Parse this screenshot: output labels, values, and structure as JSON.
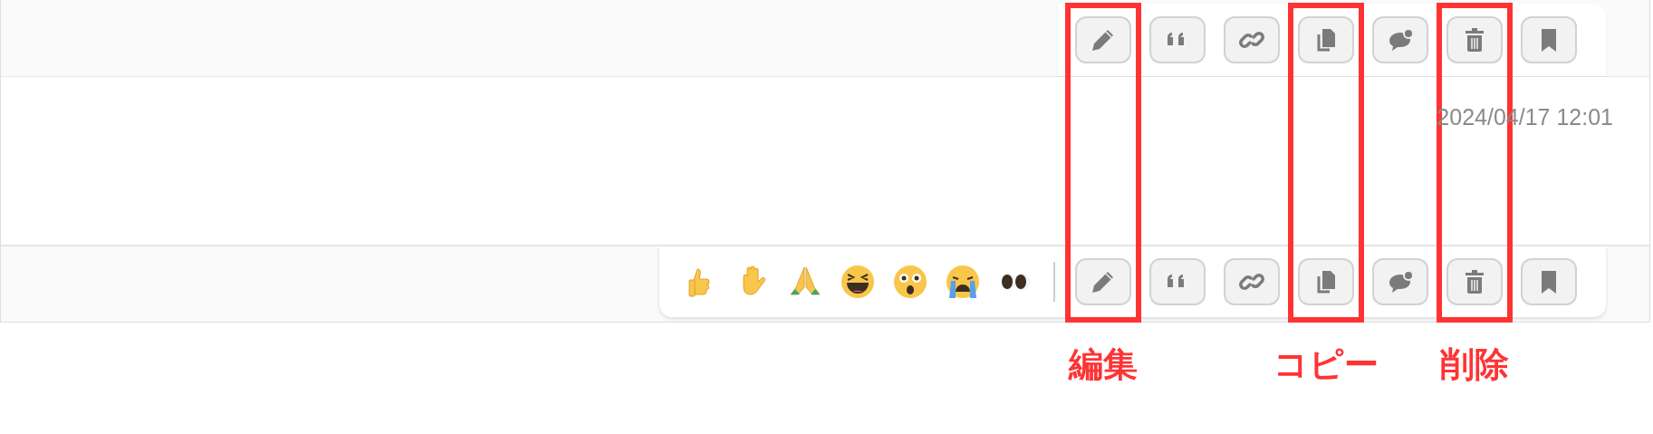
{
  "top_toolbar": {
    "actions": [
      {
        "kind": "edit",
        "highlighted": true
      },
      {
        "kind": "quote",
        "highlighted": false
      },
      {
        "kind": "link",
        "highlighted": false
      },
      {
        "kind": "copy",
        "highlighted": true
      },
      {
        "kind": "reply",
        "highlighted": false
      },
      {
        "kind": "delete",
        "highlighted": true
      },
      {
        "kind": "bookmark",
        "highlighted": false
      }
    ]
  },
  "message": {
    "timestamp": "2024/04/17 12:01"
  },
  "bottom_toolbar": {
    "reactions": [
      {
        "kind": "thumbs-up"
      },
      {
        "kind": "raised-hand"
      },
      {
        "kind": "praying-hands"
      },
      {
        "kind": "laughing"
      },
      {
        "kind": "astonished"
      },
      {
        "kind": "crying"
      },
      {
        "kind": "eyes"
      }
    ],
    "actions": [
      {
        "kind": "edit"
      },
      {
        "kind": "quote"
      },
      {
        "kind": "link"
      },
      {
        "kind": "copy"
      },
      {
        "kind": "reply"
      },
      {
        "kind": "delete"
      },
      {
        "kind": "bookmark"
      }
    ]
  },
  "annotations": [
    "編集",
    "コピー",
    "削除"
  ]
}
